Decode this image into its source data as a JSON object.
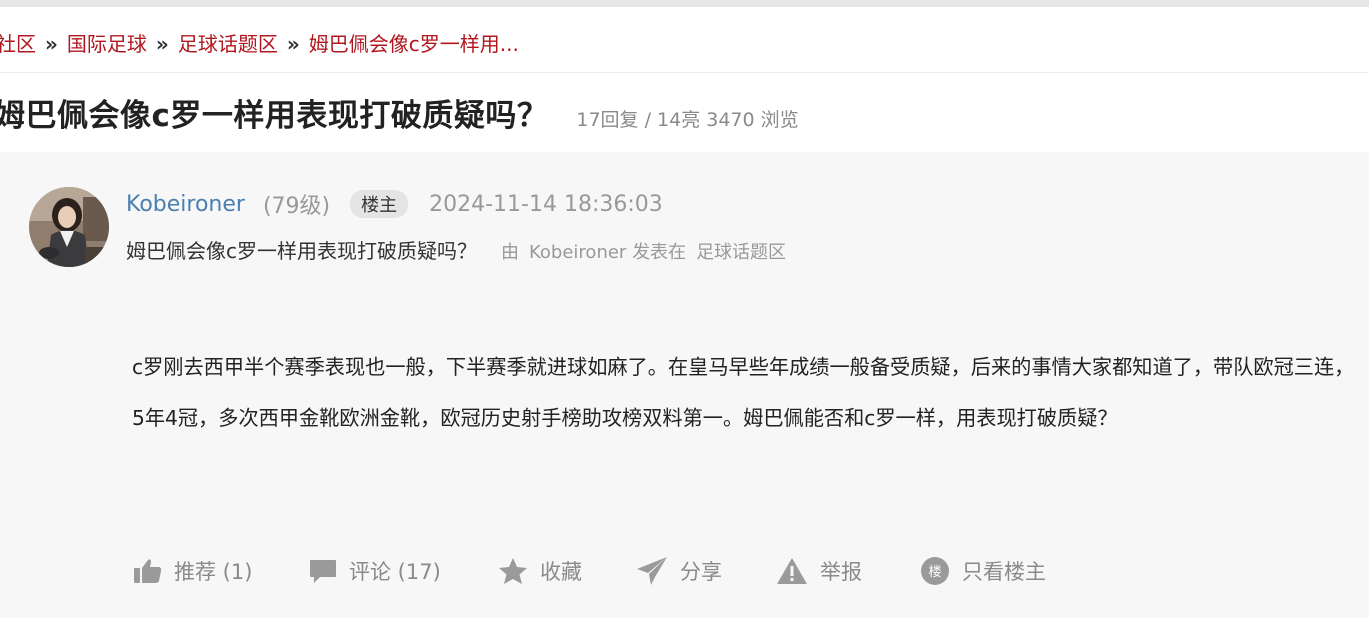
{
  "breadcrumb": {
    "items": [
      "社区",
      "国际足球",
      "足球话题区",
      "姆巴佩会像c罗一样用..."
    ],
    "separator": "»"
  },
  "thread": {
    "title": "姆巴佩会像c罗一样用表现打破质疑吗？",
    "stats": "17回复 / 14亮 3470 浏览"
  },
  "post": {
    "author": "Kobeironer",
    "level": "(79级)",
    "badge": "楼主",
    "timestamp": "2024-11-14 18:36:03",
    "subtitle": "姆巴佩会像c罗一样用表现打破质疑吗？",
    "posted_by_prefix": "由",
    "posted_by_author": "Kobeironer",
    "posted_in_text": "发表在",
    "forum": "足球话题区",
    "body": "c罗刚去西甲半个赛季表现也一般，下半赛季就进球如麻了。在皇马早些年成绩一般备受质疑，后来的事情大家都知道了，带队欧冠三连，5年4冠，多次西甲金靴欧洲金靴，欧冠历史射手榜助攻榜双料第一。姆巴佩能否和c罗一样，用表现打破质疑？"
  },
  "actions": {
    "recommend": "推荐 (1)",
    "comment": "评论 (17)",
    "favorite": "收藏",
    "share": "分享",
    "report": "举报",
    "only_op": "只看楼主",
    "only_op_icon_char": "楼"
  },
  "colors": {
    "link_red": "#b0171f",
    "author_blue": "#4a7fb0",
    "muted_gray": "#8a8a8a",
    "page_bg": "#f7f7f7"
  },
  "icons": [
    "thumbs-up-icon",
    "comment-icon",
    "star-icon",
    "paper-plane-icon",
    "warning-icon",
    "op-badge-icon"
  ]
}
